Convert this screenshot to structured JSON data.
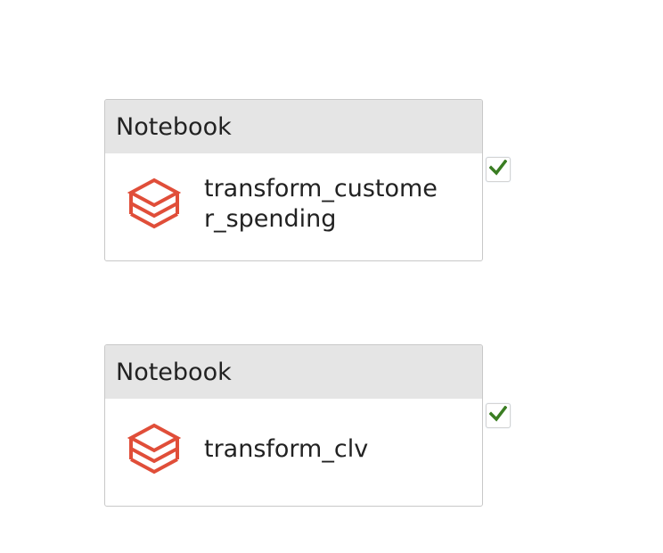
{
  "colors": {
    "notebook_icon": "#e04e39",
    "success_check": "#3a7d22",
    "header_bg": "#e5e5e5",
    "border": "#c8c8c8"
  },
  "activities": [
    {
      "type_label": "Notebook",
      "name": "transform_customer_spending",
      "icon": "databricks-notebook-icon",
      "status_icon": "success-check-icon"
    },
    {
      "type_label": "Notebook",
      "name": "transform_clv",
      "icon": "databricks-notebook-icon",
      "status_icon": "success-check-icon"
    }
  ]
}
